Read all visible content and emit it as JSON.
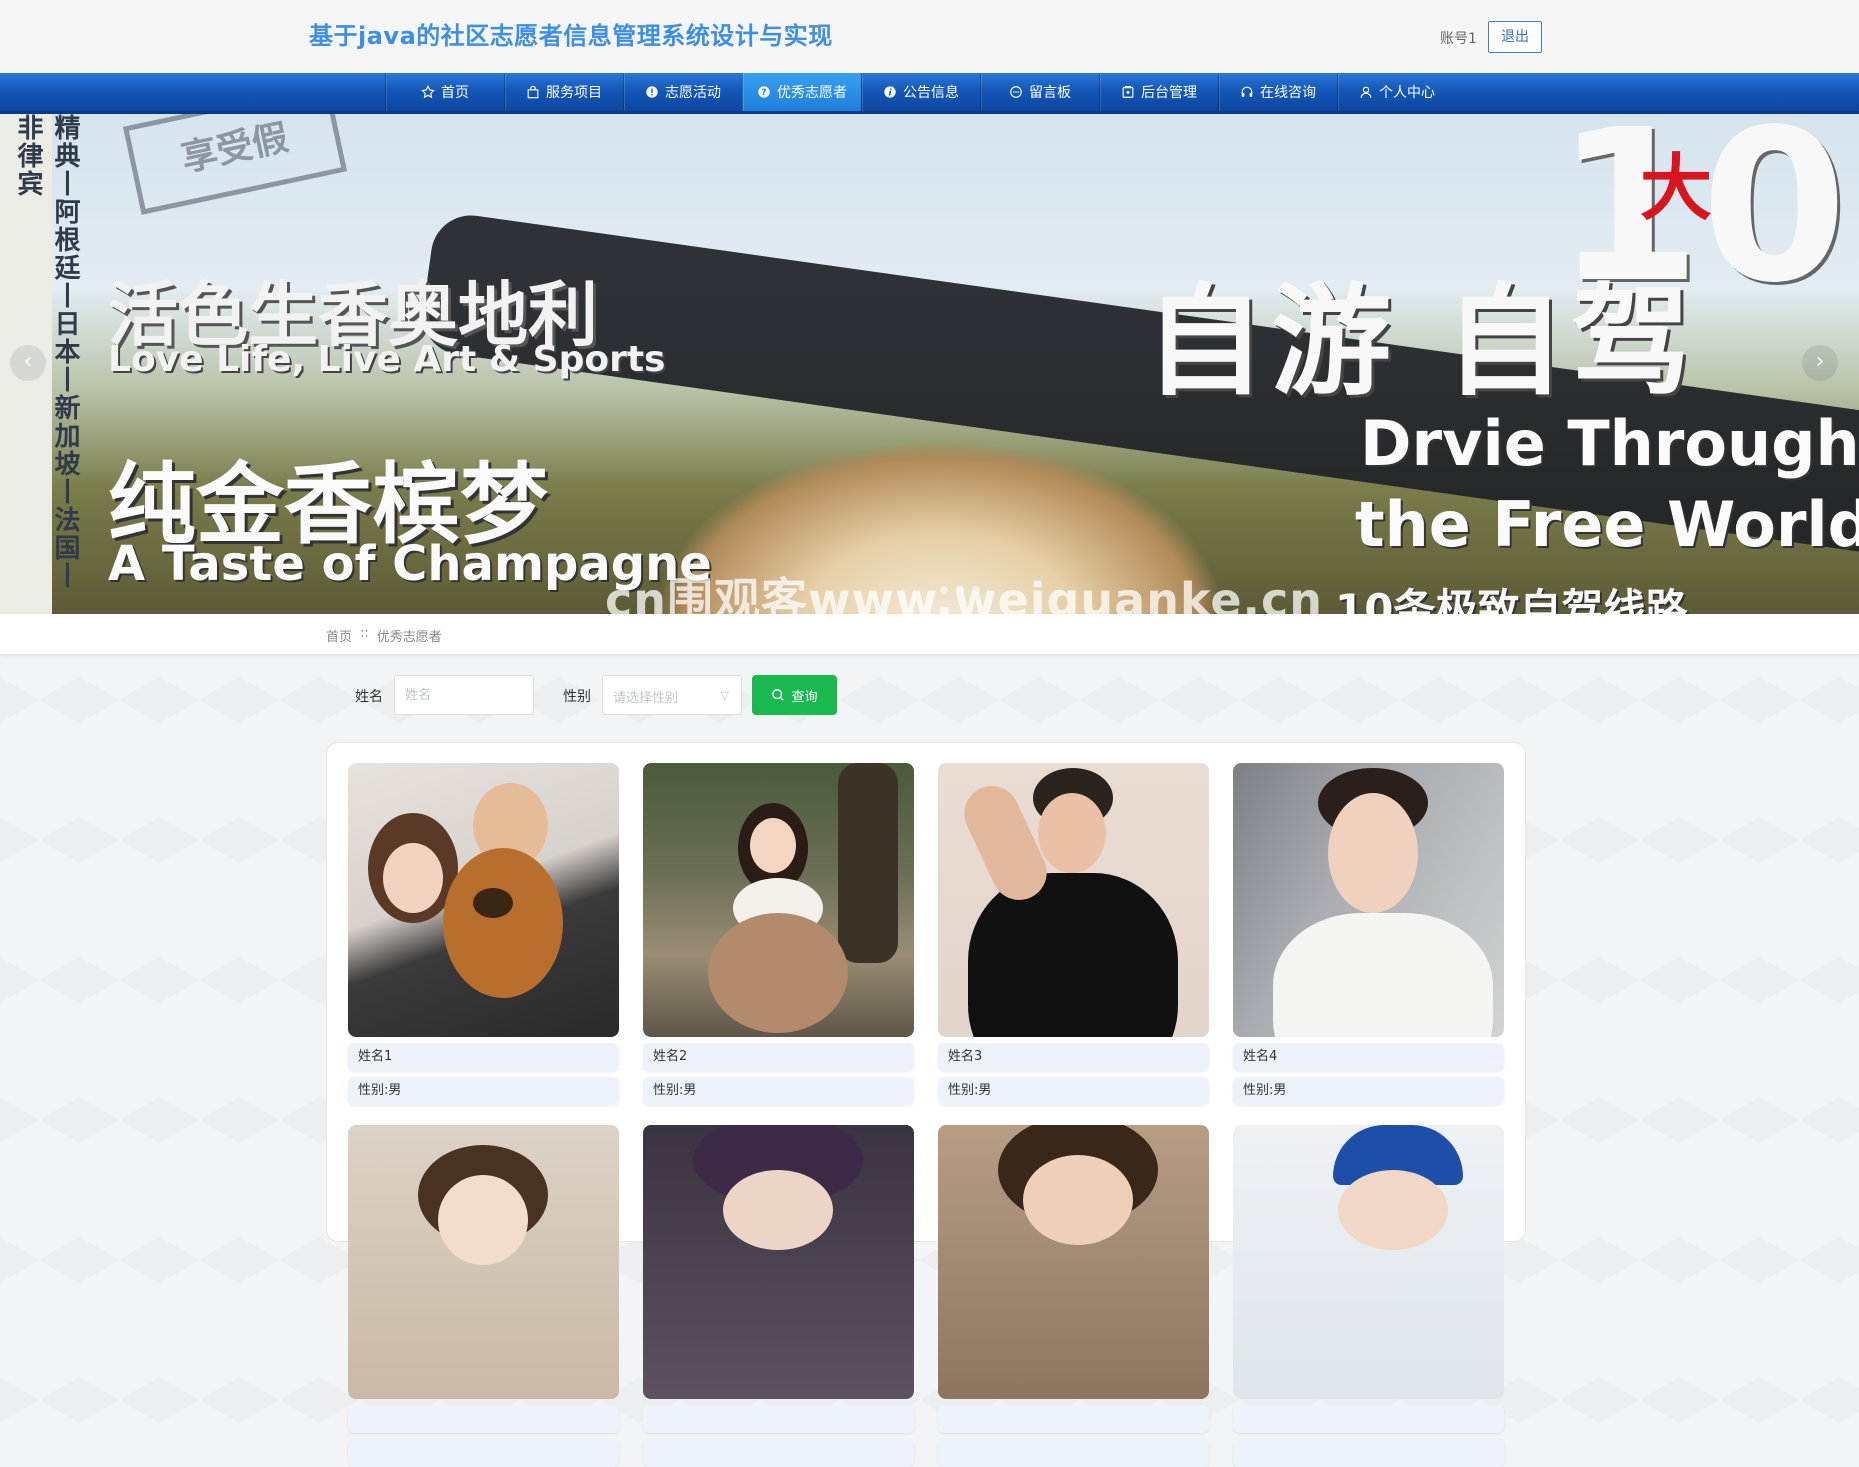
{
  "header": {
    "title": "基于java的社区志愿者信息管理系统设计与实现",
    "account": "账号1",
    "logout_label": "退出"
  },
  "nav": {
    "items": [
      {
        "label": "首页",
        "icon": "star-icon"
      },
      {
        "label": "服务项目",
        "icon": "bag-icon"
      },
      {
        "label": "志愿活动",
        "icon": "info-icon"
      },
      {
        "label": "优秀志愿者",
        "icon": "question-icon",
        "active": true
      },
      {
        "label": "公告信息",
        "icon": "warning-icon"
      },
      {
        "label": "留言板",
        "icon": "chat-icon"
      },
      {
        "label": "后台管理",
        "icon": "lock-icon"
      },
      {
        "label": "在线咨询",
        "icon": "headset-icon"
      },
      {
        "label": "个人中心",
        "icon": "user-icon"
      }
    ]
  },
  "banner": {
    "strip_text": "精典丨阿根廷丨日本丨新加坡丨法国丨非律宾",
    "badge": "享受假",
    "line1": "活色生香奥地利",
    "line2": "Love Life, Live Art & Sports",
    "line3": "纯金香槟梦",
    "line4": "A Taste of Champagne",
    "big_number": "10",
    "big_char": "大",
    "headline": "自游 自驾",
    "en_line1": "Drvie Through",
    "en_line2": "the Free World",
    "sub_line": "10条极致自驾线路",
    "watermark": "cn围观客www.weiguanke.cn",
    "slide_count": 3,
    "active_slide": 2
  },
  "breadcrumb": {
    "home": "首页",
    "separator": "::",
    "current": "优秀志愿者"
  },
  "search": {
    "name_label": "姓名",
    "name_placeholder": "姓名",
    "gender_label": "性别",
    "gender_placeholder": "请选择性别",
    "button_label": "查询"
  },
  "volunteers": [
    {
      "name": "姓名1",
      "gender": "性别:男"
    },
    {
      "name": "姓名2",
      "gender": "性别:男"
    },
    {
      "name": "姓名3",
      "gender": "性别:男"
    },
    {
      "name": "姓名4",
      "gender": "性别:男"
    },
    {
      "name": "",
      "gender": ""
    },
    {
      "name": "",
      "gender": ""
    },
    {
      "name": "",
      "gender": ""
    },
    {
      "name": "",
      "gender": ""
    }
  ],
  "colors": {
    "title": "#3d8ee6",
    "nav": "#1558b8",
    "nav_active": "#2b90e8",
    "search_button": "#19b950"
  }
}
